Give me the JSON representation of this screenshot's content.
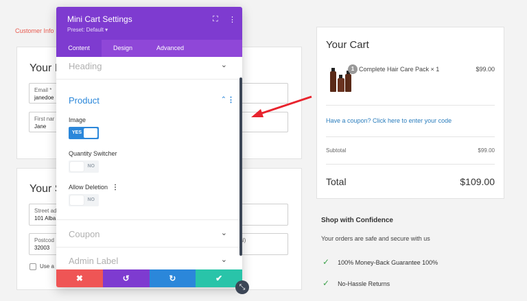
{
  "breadcrumb": "Customer Info",
  "contact": {
    "heading": "Your I",
    "email_label": "Email *",
    "email_value": "janedoe",
    "first_name_label": "First nar",
    "first_name_value": "Jane"
  },
  "shipping": {
    "heading": "Your S",
    "street_label": "Street ad",
    "street_value": "101 Alba",
    "postcode_label": "Postcod",
    "postcode_value": "32003",
    "optional_label": "nal)",
    "checkbox_label": "Use a"
  },
  "cart": {
    "title": "Your Cart",
    "item_qty_badge": "1",
    "item_name": "Complete Hair Care Pack × 1",
    "item_price": "$99.00",
    "coupon_link": "Have a coupon? Click here to enter your code",
    "subtotal_label": "Subtotal",
    "subtotal_value": "$99.00",
    "total_label": "Total",
    "total_value": "$109.00"
  },
  "confidence": {
    "title": "Shop with Confidence",
    "subtitle": "Your orders are safe and secure with us",
    "items": [
      "100% Money-Back Guarantee 100%",
      "No-Hassle Returns"
    ]
  },
  "panel": {
    "title": "Mini Cart Settings",
    "preset": "Preset: Default ▾",
    "tabs": [
      "Content",
      "Design",
      "Advanced"
    ],
    "sections": {
      "heading": "Heading",
      "product": "Product",
      "coupon": "Coupon",
      "admin_label": "Admin Label"
    },
    "options": {
      "image": {
        "label": "Image",
        "state": "YES"
      },
      "quantity_switcher": {
        "label": "Quantity Switcher",
        "state": "NO"
      },
      "allow_deletion": {
        "label": "Allow Deletion",
        "state": "NO"
      }
    },
    "footer": {
      "cancel": "✖",
      "undo": "↺",
      "redo": "↻",
      "save": "✔"
    }
  },
  "colors": {
    "panel_purple": "#7e3bd0",
    "tab_purple": "#8f47d8",
    "active_blue": "#2b87da",
    "cancel_red": "#ef5555",
    "undo_purple": "#7e3bd0",
    "redo_blue": "#2b87da",
    "save_green": "#29c4a9",
    "check_green": "#3fa34d",
    "arrow_red": "#e8242e"
  }
}
